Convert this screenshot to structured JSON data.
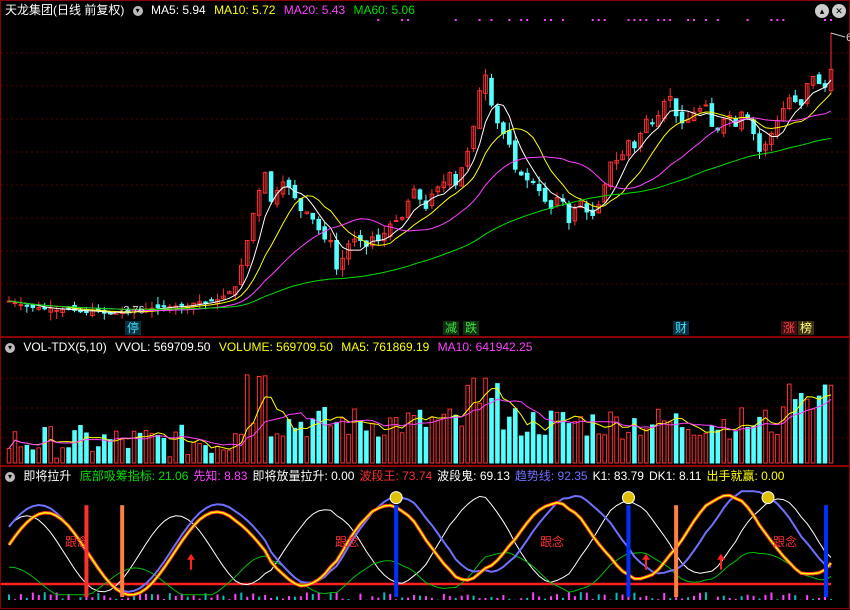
{
  "title": {
    "stock": "天龙集团(日线 前复权)",
    "ma5": "MA5: 5.94",
    "ma10": "MA10: 5.72",
    "ma20": "MA20: 5.43",
    "ma60": "MA60: 5.06"
  },
  "volume_header": {
    "name": "VOL-TDX(5,10)",
    "vvol": "VVOL: 569709.50",
    "volume": "VOLUME: 569709.50",
    "ma5": "MA5: 761869.19",
    "ma10": "MA10: 641942.25"
  },
  "indicator_header": {
    "name": "即将拉升",
    "items": [
      {
        "label": "底部吸筹指标: 21.06",
        "color": "#00e000"
      },
      {
        "label": "先知: 8.83",
        "color": "#ff40ff"
      },
      {
        "label": "即将放量拉升: 0.00",
        "color": "#ffffff"
      },
      {
        "label": "波段王: 73.74",
        "color": "#ff3030"
      },
      {
        "label": "波段鬼: 69.13",
        "color": "#ffffff"
      },
      {
        "label": "趋势线: 92.35",
        "color": "#7070ff"
      },
      {
        "label": "K1: 83.79",
        "color": "#ffffff"
      },
      {
        "label": "DK1: 8.11",
        "color": "#ffffff"
      },
      {
        "label": "出手就赢: 0.00",
        "color": "#ffff00"
      }
    ]
  },
  "markers": [
    {
      "text": "停",
      "color": "#40e0ff",
      "bg": "#0a3040"
    },
    {
      "text": "减",
      "color": "#40e040",
      "bg": "#103010"
    },
    {
      "text": "跌",
      "color": "#40e040",
      "bg": "#103010"
    },
    {
      "text": "财",
      "color": "#40e0ff",
      "bg": "#0a3040"
    },
    {
      "text": "涨",
      "color": "#ff4040",
      "bg": "#401010"
    },
    {
      "text": "榜",
      "color": "#ffff80",
      "bg": "#403010"
    }
  ],
  "indicator_labels": [
    "跟念",
    "跟念",
    "跟念",
    "跟念"
  ],
  "colors": {
    "up": "#ff3030",
    "down": "#54ffff",
    "ma5": "#ffffff",
    "ma10": "#ffff00",
    "ma20": "#ff40ff",
    "ma60": "#00e000",
    "border": "#8b0000"
  },
  "chart_data": {
    "type": "candlestick",
    "title": "天龙集团(日线 前复权)",
    "annotations": {
      "high": 6.71,
      "low": 2.76
    },
    "close": [
      2.95,
      2.93,
      2.9,
      2.88,
      2.86,
      2.86,
      2.84,
      2.85,
      2.82,
      2.83,
      2.84,
      2.82,
      2.8,
      2.79,
      2.81,
      2.81,
      2.78,
      2.77,
      2.79,
      2.79,
      2.8,
      2.83,
      2.82,
      2.84,
      2.85,
      2.86,
      2.87,
      2.87,
      2.88,
      2.89,
      2.88,
      2.92,
      2.94,
      2.93,
      2.95,
      2.97,
      3.02,
      3.08,
      3.15,
      3.45,
      3.8,
      4.18,
      4.5,
      4.75,
      4.35,
      4.5,
      4.62,
      4.55,
      4.4,
      4.22,
      4.2,
      4.1,
      3.95,
      3.82,
      3.8,
      3.4,
      3.55,
      3.75,
      3.82,
      3.8,
      3.72,
      3.85,
      3.8,
      3.9,
      4.03,
      4.08,
      4.12,
      4.35,
      4.52,
      4.38,
      4.25,
      4.45,
      4.55,
      4.62,
      4.75,
      4.58,
      4.82,
      5.05,
      5.4,
      5.9,
      6.12,
      5.7,
      5.45,
      5.3,
      5.15,
      4.8,
      4.72,
      4.65,
      4.62,
      4.5,
      4.35,
      4.25,
      4.4,
      4.35,
      4.05,
      4.25,
      4.35,
      4.2,
      4.15,
      4.3,
      4.58,
      4.9,
      4.92,
      5.0,
      5.2,
      5.1,
      5.3,
      5.5,
      5.45,
      5.55,
      5.75,
      5.82,
      5.55,
      5.45,
      5.5,
      5.6,
      5.65,
      5.7,
      5.4,
      5.35,
      5.5,
      5.55,
      5.4,
      5.6,
      5.5,
      5.3,
      5.05,
      5.15,
      5.3,
      5.48,
      5.65,
      5.8,
      5.75,
      5.7,
      6.0,
      6.1,
      6.0,
      5.95,
      6.2
    ]
  }
}
